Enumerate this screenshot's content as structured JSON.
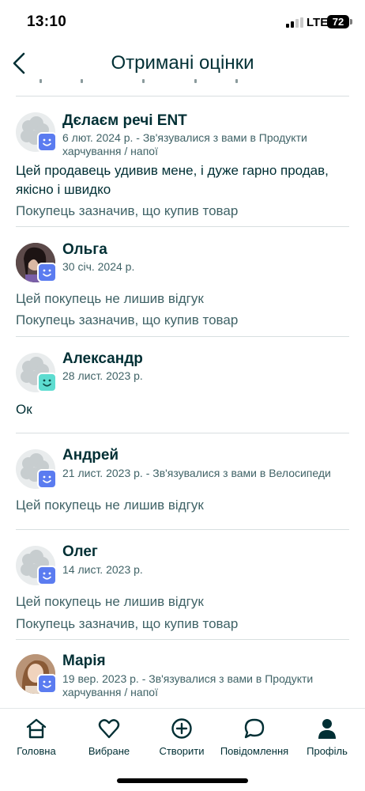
{
  "status_bar": {
    "time": "13:10",
    "network": "LTE",
    "battery": "72"
  },
  "header": {
    "title": "Отримані оцінки",
    "back_icon": "chevron-left-icon"
  },
  "reviews": [
    {
      "name": "Дєлаєм речі ENT",
      "meta": "6 лют. 2024 р. - Зв'язувалися з вами в Продукти харчування / напої",
      "comment": "Цей продавець удивив мене, і дуже гарно продав, якісно і швидко",
      "purchase": "Покупець зазначив, що купив товар",
      "badge_color": "#5b7cf0",
      "avatar": "default-avatar"
    },
    {
      "name": "Ольга",
      "meta": "30 січ. 2024 р.",
      "comment": "Цей покупець не лишив відгук",
      "purchase": "Покупець зазначив, що купив товар",
      "badge_color": "#5b7cf0",
      "avatar": "photo-avatar"
    },
    {
      "name": "Александр",
      "meta": "28 лист. 2023 р.",
      "comment": "Ок",
      "purchase": "",
      "badge_color": "#5ddcd0",
      "avatar": "default-avatar"
    },
    {
      "name": "Андрей",
      "meta": "21 лист. 2023 р. - Зв'язувалися з вами в Велосипеди",
      "comment": "Цей покупець не лишив відгук",
      "purchase": "",
      "badge_color": "#5b7cf0",
      "avatar": "default-avatar"
    },
    {
      "name": "Олег",
      "meta": "14 лист. 2023 р.",
      "comment": "Цей покупець не лишив відгук",
      "purchase": "Покупець зазначив, що купив товар",
      "badge_color": "#5b7cf0",
      "avatar": "default-avatar"
    },
    {
      "name": "Марія",
      "meta": "19 вер. 2023 р. - Зв'язувалися з вами в Продукти харчування / напої",
      "comment": "",
      "purchase": "",
      "badge_color": "#5b7cf0",
      "avatar": "photo-avatar"
    }
  ],
  "bottom_nav": [
    {
      "label": "Головна",
      "icon": "home-icon"
    },
    {
      "label": "Вибране",
      "icon": "heart-icon"
    },
    {
      "label": "Створити",
      "icon": "plus-circle-icon"
    },
    {
      "label": "Повідомлення",
      "icon": "chat-bubble-icon"
    },
    {
      "label": "Профіль",
      "icon": "person-icon"
    }
  ],
  "colors": {
    "text_primary": "#002f34",
    "text_secondary": "#406367",
    "divider": "#d8dfe0",
    "badge_blue": "#5b7cf0",
    "badge_teal": "#5ddcd0"
  }
}
